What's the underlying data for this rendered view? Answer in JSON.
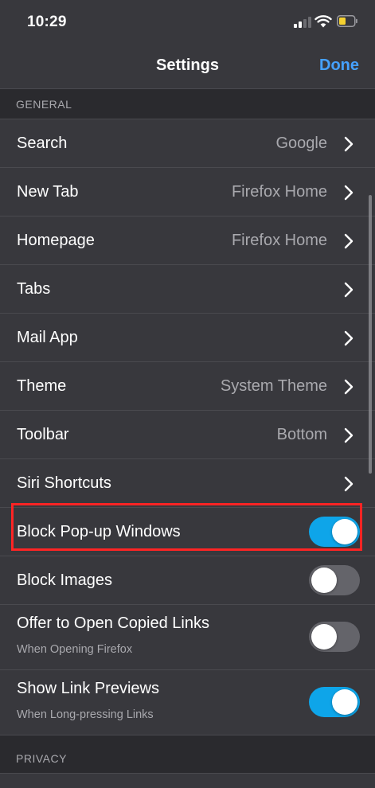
{
  "status_bar": {
    "time": "10:29",
    "icons": [
      "cellular-signal-icon",
      "wifi-icon",
      "battery-low-icon"
    ],
    "battery_color": "#f5d130"
  },
  "nav": {
    "title": "Settings",
    "done_label": "Done"
  },
  "colors": {
    "accent": "#45a1ff",
    "toggle_on": "#0ea5e9",
    "toggle_off": "#64646a",
    "highlight": "#ff2424"
  },
  "sections": {
    "general": "GENERAL",
    "privacy": "PRIVACY"
  },
  "rows": [
    {
      "label": "Search",
      "value": "Google",
      "type": "chevron"
    },
    {
      "label": "New Tab",
      "value": "Firefox Home",
      "type": "chevron"
    },
    {
      "label": "Homepage",
      "value": "Firefox Home",
      "type": "chevron"
    },
    {
      "label": "Tabs",
      "value": "",
      "type": "chevron"
    },
    {
      "label": "Mail App",
      "value": "",
      "type": "chevron"
    },
    {
      "label": "Theme",
      "value": "System Theme",
      "type": "chevron"
    },
    {
      "label": "Toolbar",
      "value": "Bottom",
      "type": "chevron"
    },
    {
      "label": "Siri Shortcuts",
      "value": "",
      "type": "chevron"
    },
    {
      "label": "Block Pop-up Windows",
      "type": "toggle",
      "on": true,
      "highlighted": true
    },
    {
      "label": "Block Images",
      "type": "toggle",
      "on": false
    },
    {
      "label": "Offer to Open Copied Links",
      "subtitle": "When Opening Firefox",
      "type": "toggle",
      "on": false
    },
    {
      "label": "Show Link Previews",
      "subtitle": "When Long-pressing Links",
      "type": "toggle",
      "on": true
    }
  ]
}
